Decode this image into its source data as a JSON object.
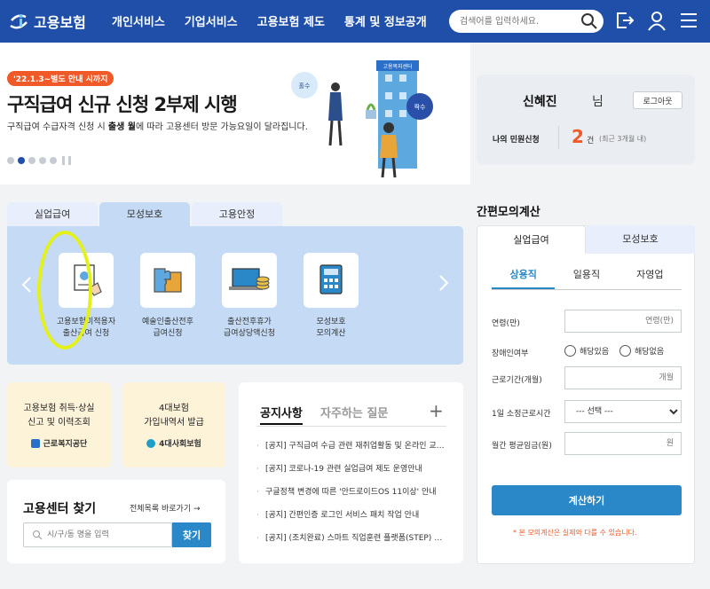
{
  "header": {
    "logo_text": "고용보험",
    "nav": [
      "개인서비스",
      "기업서비스",
      "고용보험 제도",
      "통계 및 정보공개"
    ],
    "search_placeholder": "검색어를 입력하세요."
  },
  "banner": {
    "badge": "'22.1.3~별도 안내 시까지",
    "title": "구직급여 신규 신청 2부제 시행",
    "desc_prefix": "구직급여 수급자격 신청 시 ",
    "desc_bold": "출생 월",
    "desc_suffix": "에 따라 고용센터 방문 가능요일이 달라집니다.",
    "illust_labels": {
      "odd": "홀수",
      "even": "짝수",
      "building": "고용복지센터"
    },
    "slide_count": 6,
    "active_slide": 2
  },
  "user": {
    "name": "신혜진",
    "honorific": "님",
    "logout_label": "로그아웃",
    "minwon_label": "나의 민원신청",
    "minwon_count": "2",
    "minwon_unit": "건",
    "minwon_note": "(최근 3개월 내)"
  },
  "service_tabs": [
    "실업급여",
    "모성보호",
    "고용안정"
  ],
  "service_active": "모성보호",
  "services": [
    {
      "label": "고용보험미적용자\n출산급여 신청",
      "icon": "document-hand-icon"
    },
    {
      "label": "예술인출산전후\n급여신청",
      "icon": "puzzle-icon"
    },
    {
      "label": "출산전후휴가\n급여상당액신청",
      "icon": "laptop-coins-icon"
    },
    {
      "label": "모성보호\n모의계산",
      "icon": "calculator-icon"
    }
  ],
  "cards": [
    {
      "title": "고용보험 취득·상실\n신고 및 이력조회",
      "org": "근로복지공단",
      "org_color": "#2a6fc8"
    },
    {
      "title": "4대보험\n가입내역서 발급",
      "org": "4대사회보험",
      "org_color": "#1f9fc8"
    }
  ],
  "finder": {
    "title": "고용센터 찾기",
    "link": "전체목록 바로가기",
    "placeholder": "시/구/동 명을 입력",
    "button": "찾기"
  },
  "notice": {
    "tabs": [
      "공지사항",
      "자주하는 질문"
    ],
    "items": [
      "[공지] 구직급여 수급 관련 재취업활동 및 온라인 교육 안내",
      "[공지] 코로나-19 관련 실업급여 제도 운영안내",
      "구글정책 변경에 따른 '안드로이드OS 11이상' 안내",
      "[공지] 간편인증 로그인 서비스 패치 작업 안내",
      "[공지] (조치완료) 스마트 직업훈련 플랫폼(STEP) 안내"
    ]
  },
  "calculator": {
    "title": "간편모의계산",
    "tabs": [
      "실업급여",
      "모성보호"
    ],
    "sub_tabs": [
      "상용직",
      "일용직",
      "자영업"
    ],
    "fields": {
      "age_label": "연령(만)",
      "age_placeholder": "연령(만)",
      "disability_label": "장애인여부",
      "disability_yes": "해당있음",
      "disability_no": "해당없음",
      "period_label": "근로기간(개월)",
      "period_placeholder": "개월",
      "hours_label": "1일 소정근로시간",
      "hours_selected": "--- 선택 ---",
      "wage_label": "월간 평균임금(원)",
      "wage_placeholder": "원"
    },
    "button": "계산하기",
    "note": "* 본 모의계산은 실제와 다를 수 있습니다."
  }
}
